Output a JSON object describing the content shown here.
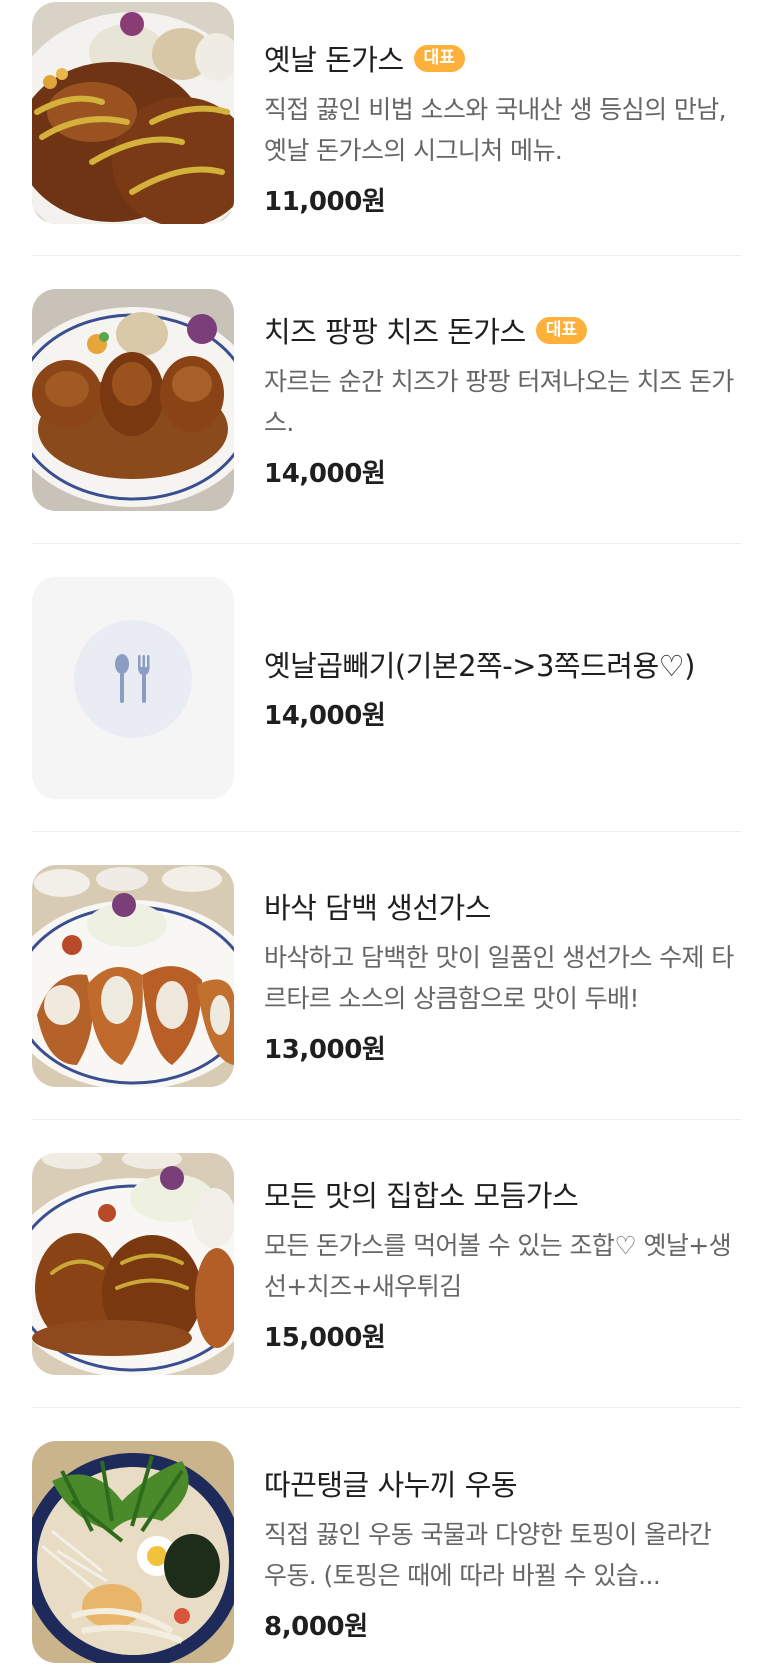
{
  "colors": {
    "badge": "#fdb13b",
    "price": "#1f1f1f",
    "description": "#666666",
    "placeholder_icon": "#8b9dc3"
  },
  "menu_items": [
    {
      "name": "옛날 돈가스",
      "badge": "대표",
      "description": "직접 끓인 비법 소스와 국내산 생 등심의 만남, 옛날 돈가스의 시그니처 메뉴.",
      "price": "11,000원",
      "image": "cutlet-with-mustard-sauce"
    },
    {
      "name": "치즈 팡팡 치즈 돈가스",
      "badge": "대표",
      "description": "자르는 순간 치즈가 팡팡 터져나오는 치즈 돈가스.",
      "price": "14,000원",
      "image": "cheese-cutlet-plate"
    },
    {
      "name": "옛날곱빼기(기본2쪽->3쪽드려용♡)",
      "badge": "",
      "description": "",
      "price": "14,000원",
      "image": "utensils-icon"
    },
    {
      "name": "바삭 담백 생선가스",
      "badge": "",
      "description": "바삭하고 담백한 맛이 일품인 생선가스 수제 타르타르 소스의 상큼함으로 맛이 두배!",
      "price": "13,000원",
      "image": "fish-cutlet-plate"
    },
    {
      "name": "모든 맛의 집합소 모듬가스",
      "badge": "",
      "description": "모든 돈가스를 먹어볼 수 있는 조합♡ 옛날+생선+치즈+새우튀김",
      "price": "15,000원",
      "image": "combo-cutlet-plate"
    },
    {
      "name": "따끈탱글 사누끼 우동",
      "badge": "",
      "description": "직접 끓인 우동 국물과 다양한 토핑이 올라간 우동. (토핑은 때에 따라 바뀔 수 있습...",
      "price": "8,000원",
      "image": "udon-bowl"
    }
  ]
}
